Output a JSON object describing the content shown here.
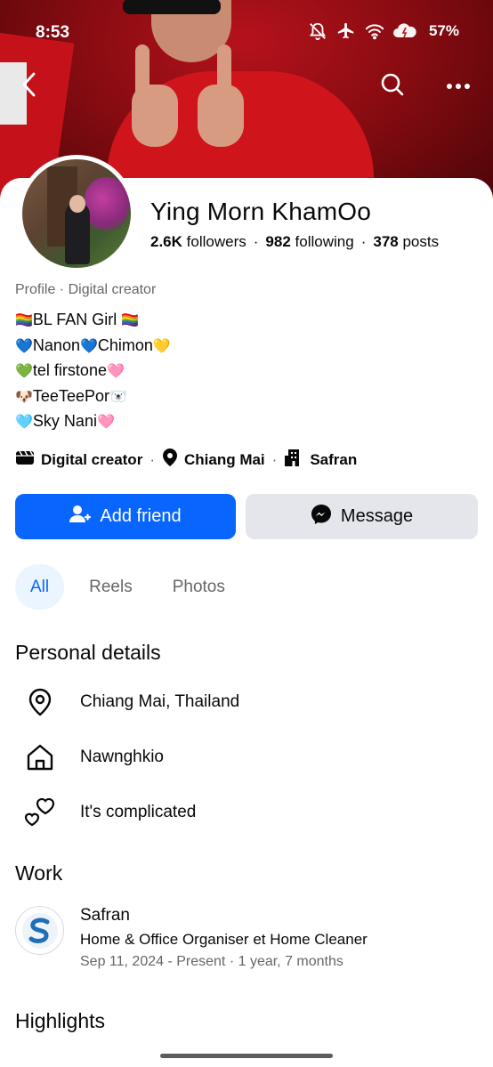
{
  "status_bar": {
    "time": "8:53",
    "battery": "57%",
    "icons": [
      "mute-icon",
      "airplane-icon",
      "wifi-icon",
      "battery-icon"
    ]
  },
  "nav": {
    "icons": [
      "back-arrow-icon",
      "search-icon",
      "more-options-icon"
    ]
  },
  "profile": {
    "name": "Ying Morn KhamOo",
    "followers_count": "2.6K",
    "followers_label": "followers",
    "following_count": "982",
    "following_label": "following",
    "posts_count": "378",
    "posts_label": "posts",
    "meta_label": "Profile",
    "meta_category": "Digital creator",
    "bio": [
      {
        "pre": "🏳️‍🌈",
        "text": "BL FAN Girl ",
        "post": "🏳️‍🌈"
      },
      {
        "pre": "💙",
        "text": "Nanon",
        "mid": "💙",
        "text2": "Chimon",
        "post": "💛"
      },
      {
        "pre": "💚",
        "text": "tel firstone",
        "post": "🩷"
      },
      {
        "pre": "🐶",
        "text": "TeeTeePor",
        "post": "🐻‍❄️"
      },
      {
        "pre": "🩵",
        "text": "Sky Nani",
        "post": "🩷"
      }
    ],
    "chips": {
      "category": "Digital creator",
      "location": "Chiang Mai",
      "workplace": "Safran"
    }
  },
  "actions": {
    "add_friend": "Add friend",
    "message": "Message"
  },
  "tabs": [
    "All",
    "Reels",
    "Photos"
  ],
  "personal_details": {
    "title": "Personal details",
    "location": "Chiang Mai, Thailand",
    "hometown": "Nawnghkio",
    "relationship": "It's complicated"
  },
  "work": {
    "title": "Work",
    "company": "Safran",
    "position": "Home & Office Organiser et Home Cleaner",
    "dates": "Sep 11, 2024 - Present",
    "duration": "1 year, 7 months"
  },
  "highlights": {
    "title": "Highlights"
  },
  "colors": {
    "primary": "#0866ff",
    "secondary_button": "#e4e6eb",
    "active_tab_bg": "#ebf5ff",
    "muted_text": "#65676b",
    "cover_red": "#b5121b"
  }
}
